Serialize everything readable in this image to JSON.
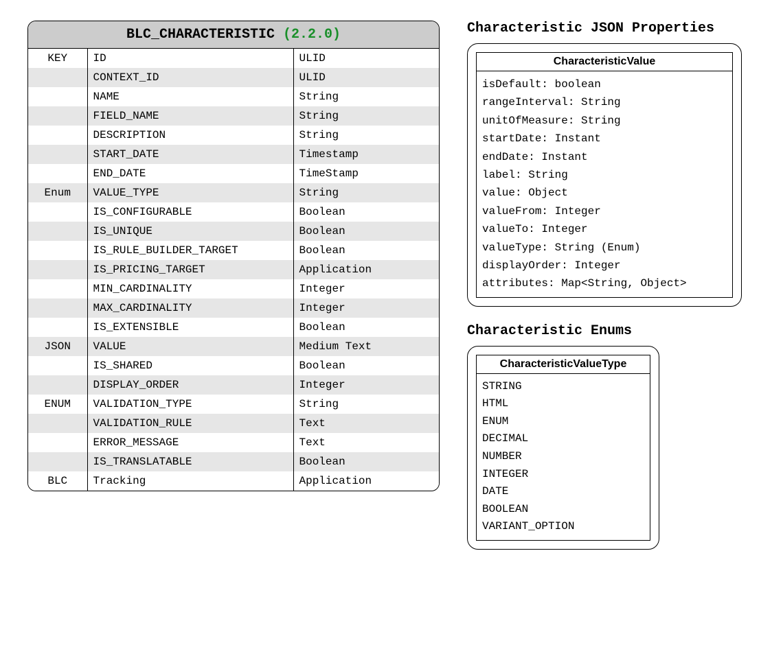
{
  "schema": {
    "title": "BLC_CHARACTERISTIC",
    "version": "(2.2.0)",
    "rows": [
      {
        "tag": "KEY",
        "name": "ID",
        "type": "ULID"
      },
      {
        "tag": "",
        "name": "CONTEXT_ID",
        "type": "ULID"
      },
      {
        "tag": "",
        "name": "NAME",
        "type": "String"
      },
      {
        "tag": "",
        "name": "FIELD_NAME",
        "type": "String"
      },
      {
        "tag": "",
        "name": "DESCRIPTION",
        "type": "String"
      },
      {
        "tag": "",
        "name": "START_DATE",
        "type": "Timestamp"
      },
      {
        "tag": "",
        "name": "END_DATE",
        "type": "TimeStamp"
      },
      {
        "tag": "Enum",
        "name": "VALUE_TYPE",
        "type": "String"
      },
      {
        "tag": "",
        "name": "IS_CONFIGURABLE",
        "type": "Boolean"
      },
      {
        "tag": "",
        "name": "IS_UNIQUE",
        "type": "Boolean"
      },
      {
        "tag": "",
        "name": "IS_RULE_BUILDER_TARGET",
        "type": "Boolean"
      },
      {
        "tag": "",
        "name": "IS_PRICING_TARGET",
        "type": "Application"
      },
      {
        "tag": "",
        "name": "MIN_CARDINALITY",
        "type": "Integer"
      },
      {
        "tag": "",
        "name": "MAX_CARDINALITY",
        "type": "Integer"
      },
      {
        "tag": "",
        "name": "IS_EXTENSIBLE",
        "type": "Boolean"
      },
      {
        "tag": "JSON",
        "name": "VALUE",
        "type": "Medium Text"
      },
      {
        "tag": "",
        "name": "IS_SHARED",
        "type": "Boolean"
      },
      {
        "tag": "",
        "name": "DISPLAY_ORDER",
        "type": "Integer"
      },
      {
        "tag": "ENUM",
        "name": "VALIDATION_TYPE",
        "type": "String"
      },
      {
        "tag": "",
        "name": "VALIDATION_RULE",
        "type": "Text"
      },
      {
        "tag": "",
        "name": "ERROR_MESSAGE",
        "type": "Text"
      },
      {
        "tag": "",
        "name": "IS_TRANSLATABLE",
        "type": "Boolean"
      },
      {
        "tag": "BLC",
        "name": "Tracking",
        "type": "Application"
      }
    ]
  },
  "json_props": {
    "heading": "Characteristic JSON Properties",
    "box_title": "CharacteristicValue",
    "lines": [
      "isDefault: boolean",
      "rangeInterval: String",
      "unitOfMeasure: String",
      "startDate: Instant",
      "endDate: Instant",
      "label: String",
      "value: Object",
      "valueFrom: Integer",
      "valueTo: Integer",
      "valueType: String (Enum)",
      "displayOrder: Integer",
      "attributes: Map<String, Object>"
    ]
  },
  "enums": {
    "heading": "Characteristic Enums",
    "box_title": "CharacteristicValueType",
    "lines": [
      "STRING",
      "HTML",
      "ENUM",
      "DECIMAL",
      "NUMBER",
      "INTEGER",
      "DATE",
      "BOOLEAN",
      "VARIANT_OPTION"
    ]
  }
}
